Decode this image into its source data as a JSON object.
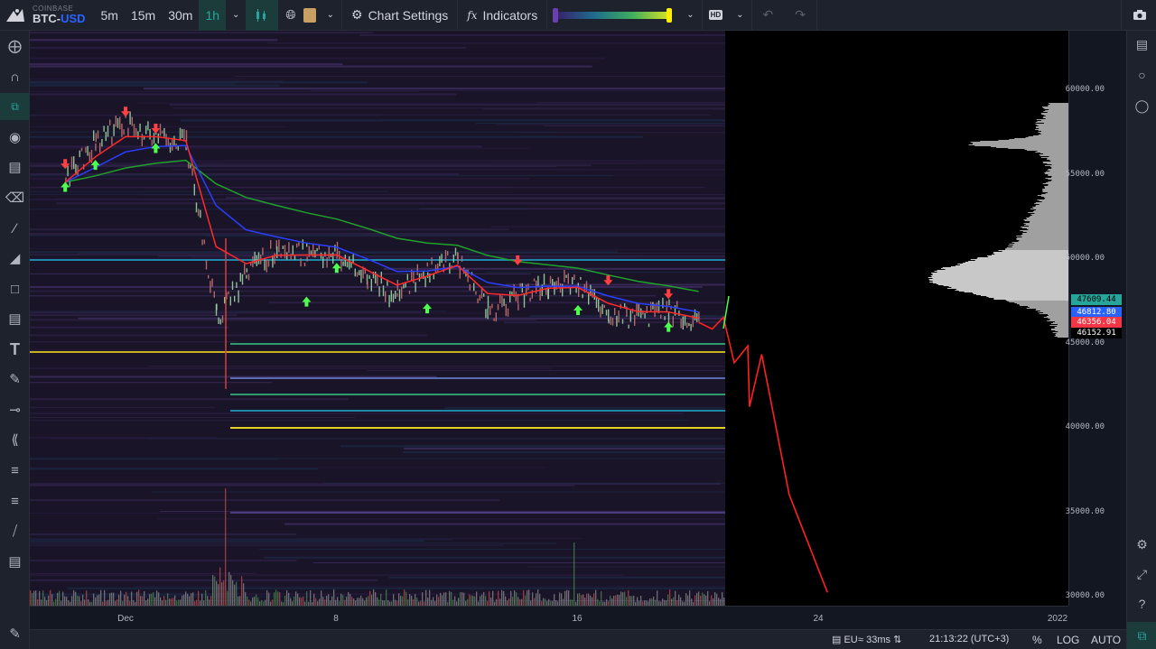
{
  "symbol": {
    "exchange": "COINBASE",
    "base": "BTC",
    "quote": "USD"
  },
  "timeframes": [
    {
      "label": "5m",
      "active": false
    },
    {
      "label": "15m",
      "active": false
    },
    {
      "label": "30m",
      "active": false
    },
    {
      "label": "1h",
      "active": true
    }
  ],
  "toolbar": {
    "chart_settings_label": "Chart Settings",
    "indicators_label": "Indicators",
    "fx_glyph": "fx",
    "hd_label": "HD"
  },
  "icons": {
    "logo": "logo-icon",
    "dropdown": "chevron-down-icon",
    "candles": "candle-chart-icon",
    "crosshair": "globe-icon",
    "lock": "lock-icon",
    "settings": "gear-icon",
    "undo": "undo-icon",
    "redo": "redo-icon",
    "camera": "camera-icon"
  },
  "left_tools": [
    "crosshair-icon",
    "magnet-icon",
    "drawing-mode-icon",
    "eye-icon",
    "lock-icon",
    "trash-icon",
    "trendline-icon",
    "fib-icon",
    "rectangle-icon",
    "ruler-icon",
    "text-icon",
    "brush-icon",
    "horizontal-ray-icon",
    "vertical-line-icon",
    "fib-retracement-icon",
    "parallel-channel-icon",
    "pencil-icon",
    "notes-icon",
    "edit-icon"
  ],
  "right_tools": [
    "book-icon",
    "chat-icon",
    "lightbulb-icon",
    "gear-icon",
    "expand-icon",
    "help-icon",
    "clock-icon",
    "hotkey-icon"
  ],
  "price_axis": {
    "labels": [
      "60000.00",
      "55000.00",
      "50000.00",
      "45000.00",
      "40000.00",
      "35000.00",
      "30000.00"
    ],
    "values": [
      60000,
      55000,
      50000,
      45000,
      40000,
      35000,
      30000
    ],
    "badges": [
      {
        "value": "47609.44",
        "bg": "#26a69a",
        "fg": "#000000"
      },
      {
        "value": "46812.80",
        "bg": "#2962ff",
        "fg": "#ffffff"
      },
      {
        "value": "46356.04",
        "bg": "#f23645",
        "fg": "#ffffff"
      },
      {
        "value": "46152.91",
        "bg": "#000000",
        "fg": "#ffffff"
      }
    ]
  },
  "time_axis": {
    "labels": [
      "Dec",
      "8",
      "16",
      "24",
      "2022"
    ]
  },
  "status": {
    "region": "EU",
    "latency": "33ms",
    "time": "21:13:22 (UTC+3)",
    "percent": "%",
    "log": "LOG",
    "auto": "AUTO",
    "sort_glyph": "⇅"
  },
  "colors": {
    "up_arrow": "#4cff4c",
    "down_arrow": "#ff4040",
    "ema_fast": "#ff2a2a",
    "ema_mid": "#2a40ff",
    "ema_slow": "#1fa32a",
    "forecast": "#ff2020"
  },
  "chart_data": {
    "type": "line",
    "symbol": "BTC-USD",
    "ylim": [
      30000,
      61000
    ],
    "price_series_dates": [
      "Nov 29",
      "Nov 30",
      "Dec 1",
      "Dec 2",
      "Dec 3",
      "Dec 4",
      "Dec 5",
      "Dec 6",
      "Dec 7",
      "Dec 8",
      "Dec 9",
      "Dec 10",
      "Dec 11",
      "Dec 12",
      "Dec 13",
      "Dec 14",
      "Dec 15",
      "Dec 16",
      "Dec 17",
      "Dec 18",
      "Dec 19",
      "Dec 20"
    ],
    "price_series": [
      54500,
      57000,
      58000,
      57200,
      56800,
      46500,
      49000,
      50500,
      50200,
      50200,
      48700,
      47800,
      49300,
      50000,
      46800,
      47700,
      48500,
      48300,
      46700,
      46500,
      46800,
      46200
    ],
    "forecast": {
      "x": [
        "Dec 20",
        "Dec 20",
        "Dec 21",
        "Dec 21",
        "Dec 21",
        "Dec 22",
        "Dec 22",
        "Dec 23",
        "Dec 24"
      ],
      "y": [
        46200,
        45800,
        46500,
        43800,
        44800,
        41200,
        44300,
        36000,
        30200
      ]
    }
  }
}
